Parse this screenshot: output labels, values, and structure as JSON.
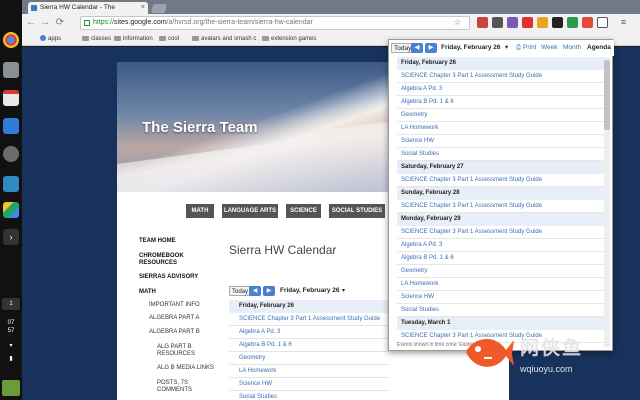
{
  "browser": {
    "tab_title": "Sierra HW Calendar - The",
    "url_scheme": "https://",
    "url_host": "sites.google.com",
    "url_path": "/a/hvrsd.org/the-sierra-team/sierra-hw-calendar"
  },
  "bookmarks": [
    "apps",
    "classes",
    "information",
    "cool",
    "avatars and smash c",
    "extension games"
  ],
  "site": {
    "title": "The Sierra Team",
    "nav": [
      "MATH",
      "LANGUAGE ARTS",
      "SCIENCE",
      "SOCIAL STUDIES"
    ],
    "page_heading": "Sierra HW Calendar",
    "sidenav": [
      {
        "label": "TEAM HOME",
        "level": "top"
      },
      {
        "label": "CHROMEBOOK",
        "level": "top"
      },
      {
        "label": "RESOURCES",
        "level": "top"
      },
      {
        "label": "SIERRAS ADVISORY",
        "level": "top"
      },
      {
        "label": "MATH",
        "level": "top"
      },
      {
        "label": "IMPORTANT INFO",
        "level": "sub"
      },
      {
        "label": "ALGEBRA PART A",
        "level": "sub"
      },
      {
        "label": "ALGEBRA PART B",
        "level": "sub"
      },
      {
        "label": "ALG PART B",
        "level": "sub"
      },
      {
        "label": "RESOURCES",
        "level": "sub"
      },
      {
        "label": "ALG B MEDIA LINKS",
        "level": "sub"
      },
      {
        "label": "POSTS, 7S",
        "level": "sub"
      },
      {
        "label": "COMMENTS",
        "level": "sub"
      }
    ]
  },
  "calendar_inline": {
    "today_label": "Today",
    "date_label": "Friday, February 26",
    "rows": [
      {
        "type": "date",
        "text": "Friday, February 26"
      },
      {
        "type": "event",
        "text": "SCIENCE Chapter 3 Part 1 Assessment Study Guide"
      },
      {
        "type": "event",
        "text": "Algebra A Pd. 3"
      },
      {
        "type": "event",
        "text": "Algebra B Pd. 1 & 6"
      },
      {
        "type": "event",
        "text": "Geometry"
      },
      {
        "type": "event",
        "text": "LA Homework"
      },
      {
        "type": "event",
        "text": "Science HW"
      },
      {
        "type": "event",
        "text": "Social Studies"
      }
    ]
  },
  "popup": {
    "today_label": "Today",
    "date_label": "Friday, February 26",
    "print_label": "Print",
    "views": [
      "Week",
      "Month",
      "Agenda"
    ],
    "rows": [
      {
        "type": "date",
        "text": "Friday, February 26"
      },
      {
        "type": "event",
        "text": "SCIENCE Chapter 3 Part 1 Assessment Study Guide"
      },
      {
        "type": "event",
        "text": "Algebra A Pd. 3"
      },
      {
        "type": "event",
        "text": "Algebra B Pd. 1 & 6"
      },
      {
        "type": "event",
        "text": "Geometry"
      },
      {
        "type": "event",
        "text": "LA Homework"
      },
      {
        "type": "event",
        "text": "Science HW"
      },
      {
        "type": "event",
        "text": "Social Studies"
      },
      {
        "type": "date",
        "text": "Saturday, February 27"
      },
      {
        "type": "event",
        "text": "SCIENCE Chapter 3 Part 1 Assessment Study Guide"
      },
      {
        "type": "date",
        "text": "Sunday, February 28"
      },
      {
        "type": "event",
        "text": "SCIENCE Chapter 3 Part 1 Assessment Study Guide"
      },
      {
        "type": "date",
        "text": "Monday, February 29"
      },
      {
        "type": "event",
        "text": "SCIENCE Chapter 3 Part 1 Assessment Study Guide"
      },
      {
        "type": "event",
        "text": "Algebra A Pd. 3"
      },
      {
        "type": "event",
        "text": "Algebra B Pd. 1 & 6"
      },
      {
        "type": "event",
        "text": "Geometry"
      },
      {
        "type": "event",
        "text": "LA Homework"
      },
      {
        "type": "event",
        "text": "Science HW"
      },
      {
        "type": "event",
        "text": "Social Studies"
      },
      {
        "type": "date",
        "text": "Tuesday, March 1"
      },
      {
        "type": "event",
        "text": "SCIENCE Chapter 3 Part 1 Assessment Study Guide"
      }
    ],
    "footer": "Events shown in time zone: Eastern"
  },
  "os_shelf": {
    "badge_count": "1",
    "time_hour": "07",
    "time_min": "57"
  },
  "watermark": {
    "cn": "网侠鱼",
    "url": "wqiuoyu.com"
  },
  "colors": {
    "accent": "#4a7fd1",
    "link": "#3a6fb4",
    "page_bg": "#17325c"
  }
}
